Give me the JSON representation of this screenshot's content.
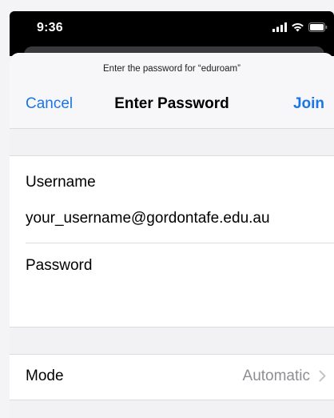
{
  "status_bar": {
    "time": "9:36",
    "icons": [
      "cellular-signal-icon",
      "wifi-icon",
      "battery-icon"
    ]
  },
  "nav": {
    "prompt": "Enter the password for “eduroam”",
    "cancel_label": "Cancel",
    "title": "Enter Password",
    "join_label": "Join"
  },
  "credentials": {
    "username_label": "Username",
    "username_value": "your_username@gordontafe.edu.au",
    "password_label": "Password",
    "password_value": ""
  },
  "mode": {
    "label": "Mode",
    "value": "Automatic",
    "icon": "chevron-right-icon"
  },
  "colors": {
    "accent": "#1a76e8",
    "background": "#f2f2f4",
    "secondary_text": "#8e8e93"
  }
}
